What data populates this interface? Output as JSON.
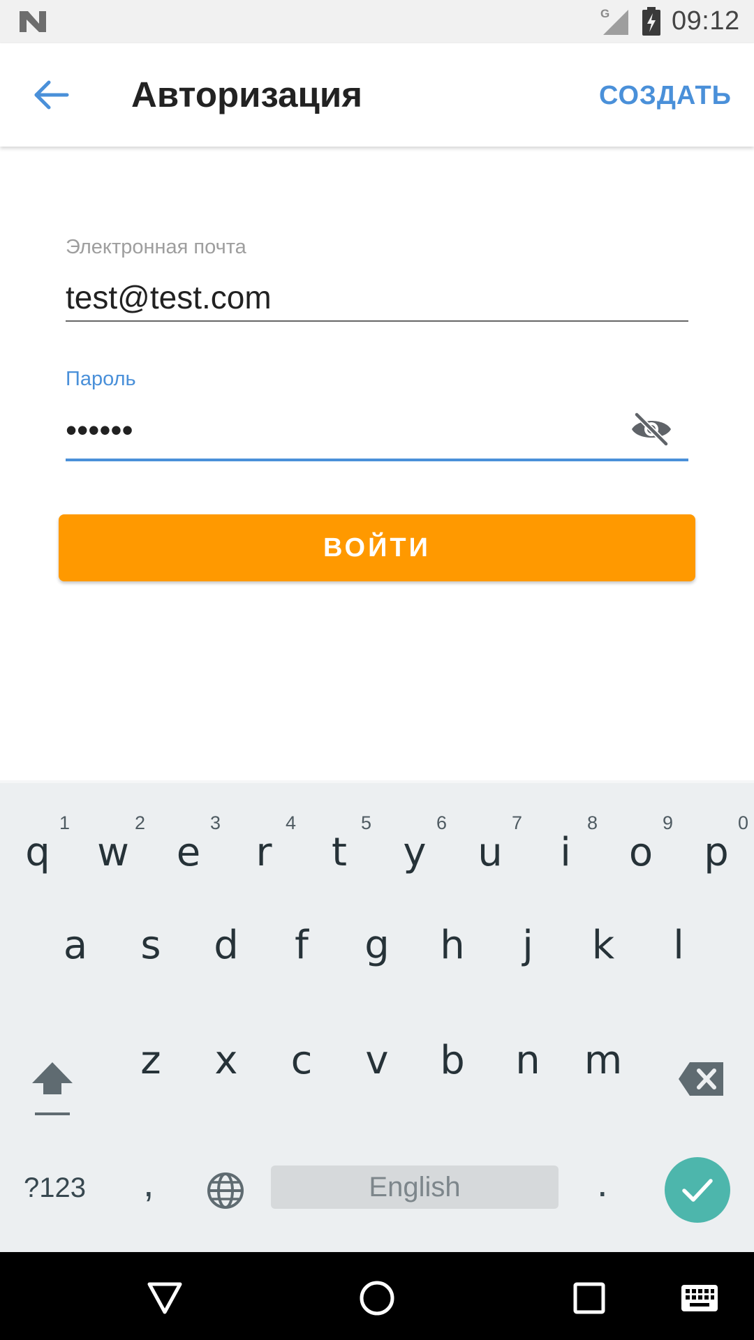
{
  "status_bar": {
    "network": "G",
    "time": "09:12"
  },
  "app_bar": {
    "title": "Авторизация",
    "action_label": "СОЗДАТЬ"
  },
  "form": {
    "email_label": "Электронная почта",
    "email_value": "test@test.com",
    "password_label": "Пароль",
    "password_value": "••••••",
    "submit_label": "ВОЙТИ"
  },
  "keyboard": {
    "row1": [
      {
        "letter": "q",
        "hint": "1"
      },
      {
        "letter": "w",
        "hint": "2"
      },
      {
        "letter": "e",
        "hint": "3"
      },
      {
        "letter": "r",
        "hint": "4"
      },
      {
        "letter": "t",
        "hint": "5"
      },
      {
        "letter": "y",
        "hint": "6"
      },
      {
        "letter": "u",
        "hint": "7"
      },
      {
        "letter": "i",
        "hint": "8"
      },
      {
        "letter": "o",
        "hint": "9"
      },
      {
        "letter": "p",
        "hint": "0"
      }
    ],
    "row2": [
      "a",
      "s",
      "d",
      "f",
      "g",
      "h",
      "j",
      "k",
      "l"
    ],
    "row3": [
      "z",
      "x",
      "c",
      "v",
      "b",
      "n",
      "m"
    ],
    "symbols_label": "?123",
    "comma": ",",
    "space_label": "English",
    "period": "."
  },
  "colors": {
    "accent": "#4a90d9",
    "button": "#ff9900",
    "enter": "#4db6ac"
  }
}
